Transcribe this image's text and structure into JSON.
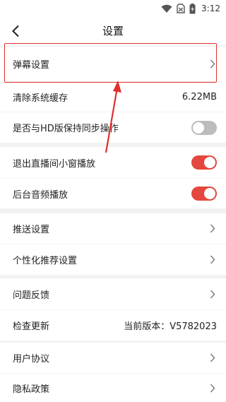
{
  "status": {
    "time": "3:12"
  },
  "header": {
    "title": "设置"
  },
  "settings": {
    "danmaku": {
      "label": "弹幕设置"
    },
    "clear_cache": {
      "label": "清除系统缓存",
      "value": "6.22MB"
    },
    "hd_sync": {
      "label": "是否与HD版保持同步操作",
      "enabled": false
    },
    "mini_window": {
      "label": "退出直播间小窗播放",
      "enabled": true
    },
    "bg_audio": {
      "label": "后台音频播放",
      "enabled": true
    },
    "push": {
      "label": "推送设置"
    },
    "personalized": {
      "label": "个性化推荐设置"
    },
    "feedback": {
      "label": "问题反馈"
    },
    "check_update": {
      "label": "检查更新",
      "value": "当前版本：V5782023"
    },
    "user_agreement": {
      "label": "用户协议"
    },
    "privacy": {
      "label": "隐私政策"
    }
  },
  "colors": {
    "accent": "#e4473d",
    "highlight": "#e0302b",
    "toggle_off": "#bcbcbc",
    "background": "#f2f2f2"
  },
  "icons": {
    "back": "back-arrow-icon",
    "chevron": "chevron-right-icon",
    "wifi": "wifi-icon",
    "signal": "no-sim-icon",
    "battery": "battery-charging-icon"
  }
}
